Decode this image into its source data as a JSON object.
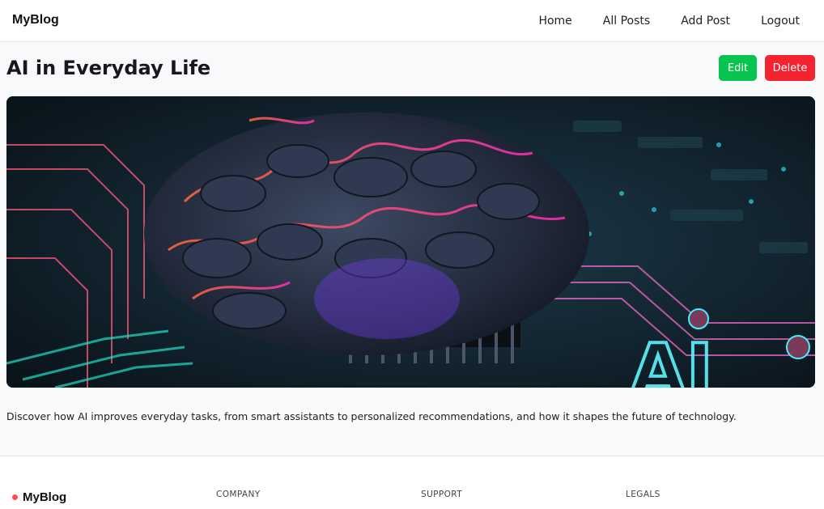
{
  "navbar": {
    "brand": "MyBlog",
    "links": [
      "Home",
      "All Posts",
      "Add Post",
      "Logout"
    ]
  },
  "post": {
    "title": "AI in Everyday Life",
    "edit_label": "Edit",
    "delete_label": "Delete",
    "image_alt": "Glowing neon brain on a circuit board",
    "description": "Discover how AI improves everyday tasks, from smart assistants to personalized recommendations, and how it shapes the future of technology."
  },
  "footer": {
    "brand": "MyBlog",
    "columns": [
      "COMPANY",
      "SUPPORT",
      "LEGALS"
    ]
  },
  "colors": {
    "edit": "#07c34f",
    "delete": "#f5222f",
    "brand_dot": "#ff4d57"
  }
}
